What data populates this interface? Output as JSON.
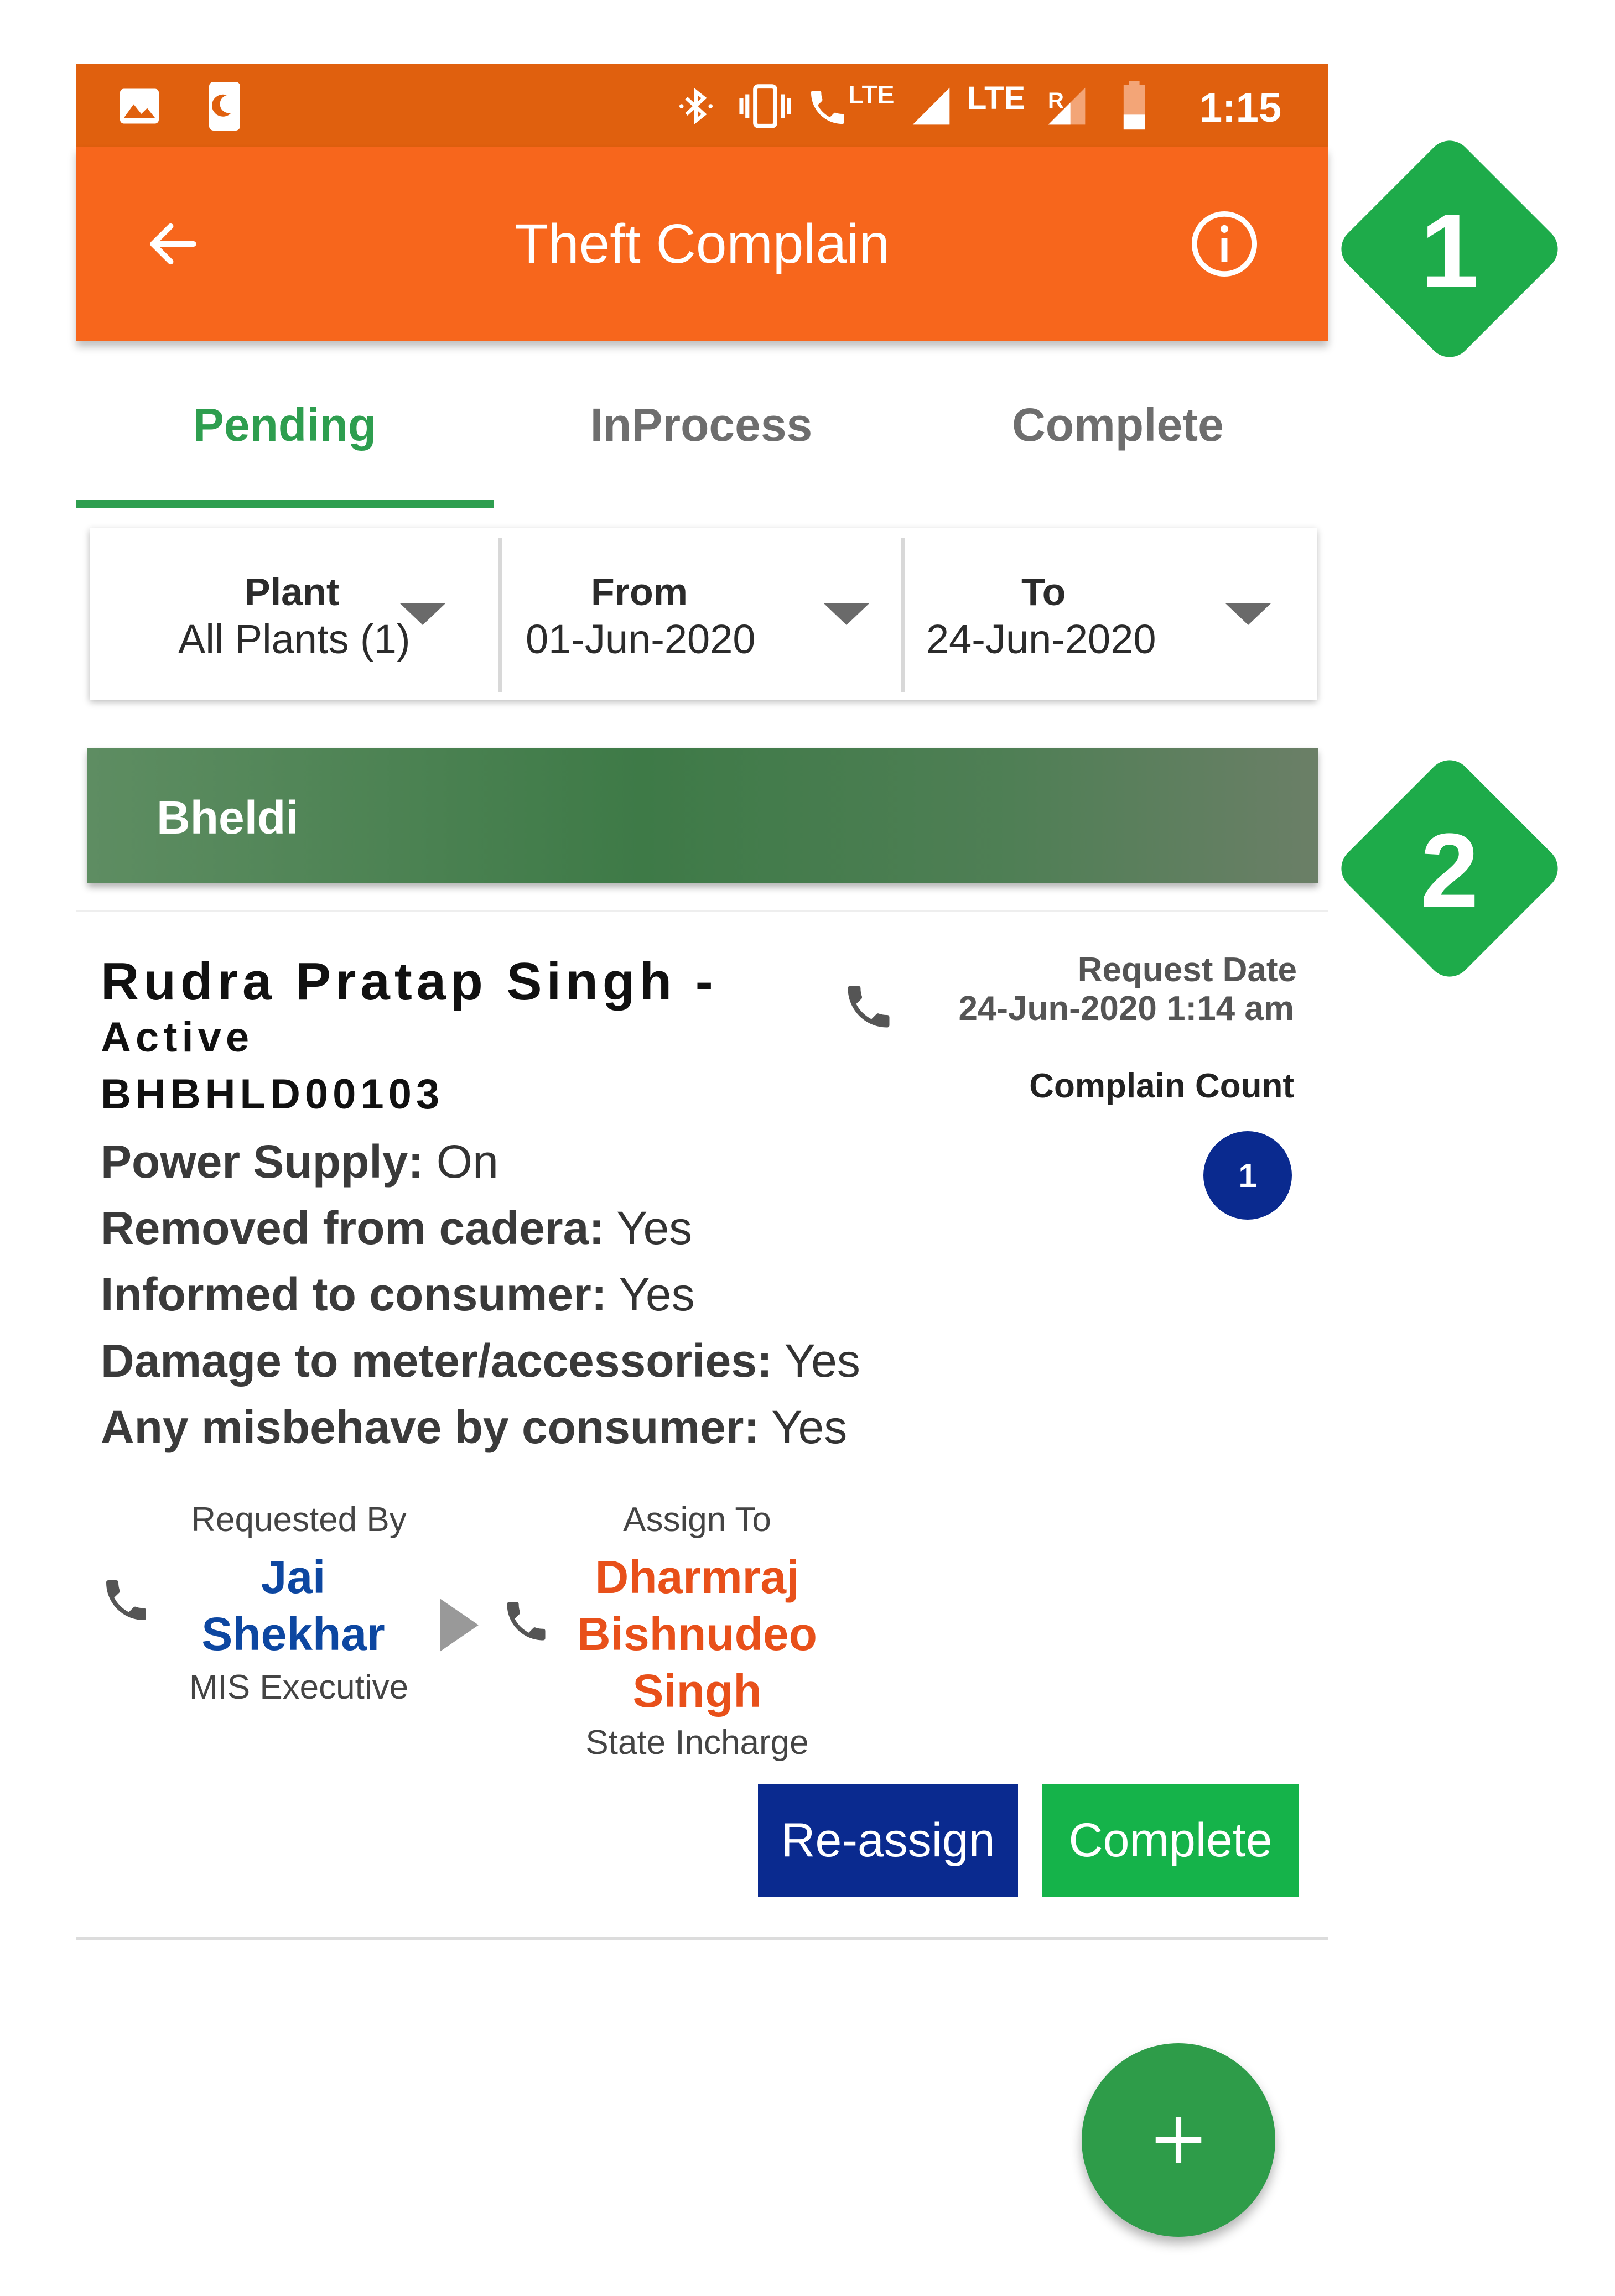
{
  "status_bar": {
    "time": "1:15",
    "lte1": "LTE",
    "lte2": "LTE",
    "roaming": "R",
    "icons": [
      "image-icon",
      "sim-app-icon",
      "bluetooth-icon",
      "vibrate-icon",
      "lte-call-icon",
      "signal-icon",
      "signal-roaming-icon",
      "battery-icon"
    ]
  },
  "app_bar": {
    "title": "Theft Complain",
    "back_icon": "arrow-left-icon",
    "info_icon": "info-icon",
    "color": "#f7661c"
  },
  "tabs": [
    {
      "label": "Pending",
      "active": true
    },
    {
      "label": "InProcess",
      "active": false
    },
    {
      "label": "Complete",
      "active": false
    }
  ],
  "filters": {
    "plant": {
      "label": "Plant",
      "value": "All Plants (1)"
    },
    "from": {
      "label": "From",
      "value": "01-Jun-2020"
    },
    "to": {
      "label": "To",
      "value": "24-Jun-2020"
    }
  },
  "group": {
    "title": "Bheldi"
  },
  "callouts": [
    "1",
    "2"
  ],
  "card": {
    "name": "Rudra Pratap Singh -",
    "status": "Active",
    "id": "BHBHLD00103",
    "request_date_label": "Request Date",
    "request_date_value": "24-Jun-2020 1:14 am",
    "complain_count_label": "Complain Count",
    "complain_count": "1",
    "fields": [
      {
        "label": "Power Supply:",
        "value": "On"
      },
      {
        "label": "Removed from cadera:",
        "value": "Yes"
      },
      {
        "label": "Informed to consumer:",
        "value": "Yes"
      },
      {
        "label": "Damage to meter/accessories:",
        "value": "Yes"
      },
      {
        "label": "Any misbehave by consumer:",
        "value": "Yes"
      }
    ],
    "requested_by": {
      "label": "Requested By",
      "name_line1": "Jai",
      "name_line2": "Shekhar",
      "role": "MIS Executive"
    },
    "assign_to": {
      "label": "Assign To",
      "name_line1": "Dharmraj",
      "name_line2": "Bishnudeo",
      "name_line3": "Singh",
      "role": "State Incharge"
    },
    "buttons": {
      "reassign": "Re-assign",
      "complete": "Complete"
    },
    "colors": {
      "requested_name": "#0d47a1",
      "assigned_name": "#e8501a",
      "reassign_bg": "#0a2a8f",
      "complete_bg": "#15b34a"
    }
  },
  "fab": {
    "icon": "plus-icon"
  }
}
